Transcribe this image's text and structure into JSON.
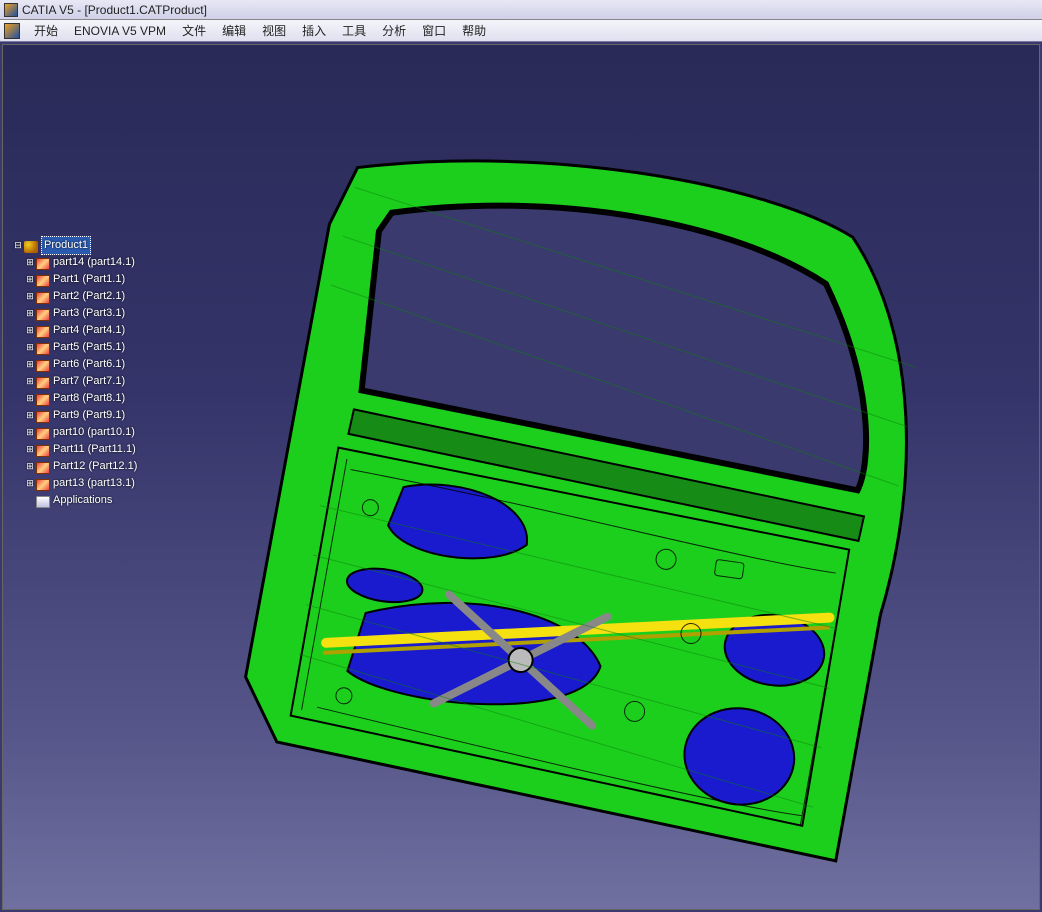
{
  "window": {
    "title": "CATIA V5 - [Product1.CATProduct]"
  },
  "menubar": {
    "items": [
      "开始",
      "ENOVIA V5 VPM",
      "文件",
      "编辑",
      "视图",
      "插入",
      "工具",
      "分析",
      "窗口",
      "帮助"
    ]
  },
  "tree": {
    "root_label": "Product1",
    "items": [
      {
        "label": "part14 (part14.1)"
      },
      {
        "label": "Part1 (Part1.1)"
      },
      {
        "label": "Part2 (Part2.1)"
      },
      {
        "label": "Part3 (Part3.1)"
      },
      {
        "label": "Part4 (Part4.1)"
      },
      {
        "label": "Part5 (Part5.1)"
      },
      {
        "label": "Part6 (Part6.1)"
      },
      {
        "label": "Part7 (Part7.1)"
      },
      {
        "label": "Part8 (Part8.1)"
      },
      {
        "label": "Part9 (Part9.1)"
      },
      {
        "label": "part10 (part10.1)"
      },
      {
        "label": "Part11 (Part11.1)"
      },
      {
        "label": "Part12 (Part12.1)"
      },
      {
        "label": "part13 (part13.1)"
      }
    ],
    "applications_label": "Applications"
  },
  "model": {
    "description": "car-door-inner-panel",
    "colors": {
      "surface": "#1dcf1d",
      "edge": "#000000",
      "skin_back": "#1a1acf",
      "beam": "#f5e010",
      "metal": "#bfbfbf"
    }
  }
}
